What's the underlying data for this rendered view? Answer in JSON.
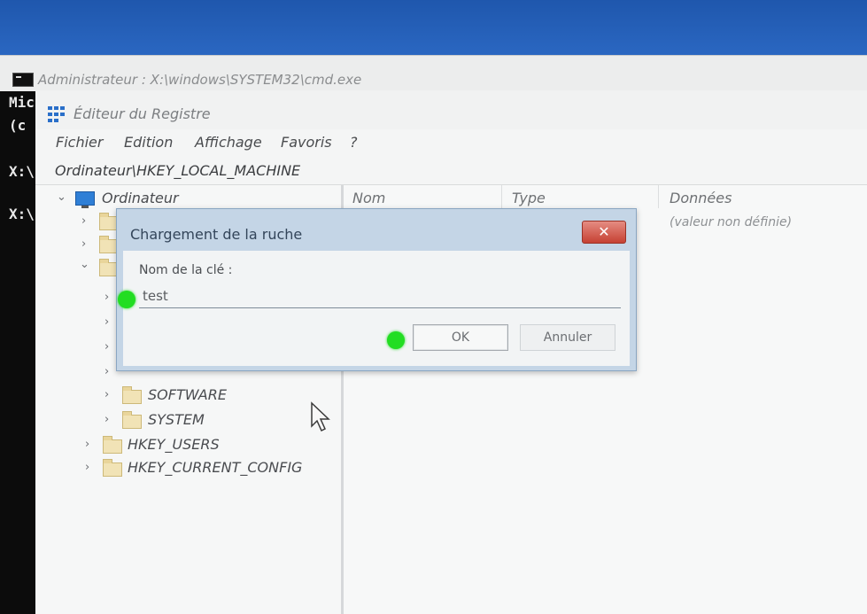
{
  "cmd": {
    "title": "Administrateur : X:\\windows\\SYSTEM32\\cmd.exe",
    "lines": [
      "Mic",
      "(c",
      "X:\\",
      "X:\\"
    ]
  },
  "regedit": {
    "title": "Éditeur du Registre",
    "menu": [
      "Fichier",
      "Edition",
      "Affichage",
      "Favoris",
      "?"
    ],
    "address": "Ordinateur\\HKEY_LOCAL_MACHINE",
    "tree": {
      "root": "Ordinateur",
      "software": "SOFTWARE",
      "system": "SYSTEM",
      "users": "HKEY_USERS",
      "current_config": "HKEY_CURRENT_CONFIG"
    },
    "columns": {
      "name": "Nom",
      "type": "Type",
      "data": "Données"
    },
    "default_value": "(valeur non définie)"
  },
  "dialog": {
    "title": "Chargement de la ruche",
    "close_glyph": "✕",
    "label": "Nom de la clé :",
    "input_value": "test",
    "ok_label": "OK",
    "cancel_label": "Annuler"
  },
  "colors": {
    "marker": "#22dd22",
    "dialog_frame": "#c4d5e6",
    "close_button": "#c64133"
  }
}
